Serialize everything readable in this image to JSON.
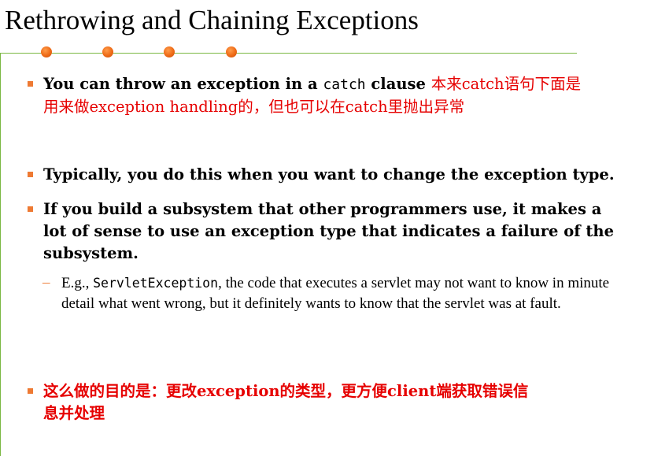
{
  "title": "Rethrowing and Chaining Exceptions",
  "bullets": {
    "b1": {
      "text_before": "You can throw an exception in a ",
      "code": "catch",
      "text_after": " clause ",
      "note_line1": "本来catch语句下面是",
      "note_line2": "用来做exception handling的，但也可以在catch里抛出异常"
    },
    "b2": {
      "text": "Typically, you do this when you want to change the exception type."
    },
    "b3": {
      "text": "If you build a subsystem that other programmers use, it makes a lot of sense to use an exception type that indicates a failure of the subsystem."
    },
    "sub1": {
      "dash": "–",
      "prefix": "E.g., ",
      "code": "ServletException",
      "text": ", the code that executes a servlet may not want to know in minute detail what went wrong, but it definitely wants to know that the servlet was at fault."
    },
    "b4": {
      "text_line1": "这么做的目的是：更改exception的类型，更方便client端获取错误信",
      "text_line2": "息并处理"
    }
  },
  "colors": {
    "accent_red": "#e60000",
    "bullet_orange": "#ee7a33",
    "rule_green": "#7ab842",
    "dot_orange": "#ee6a16"
  }
}
